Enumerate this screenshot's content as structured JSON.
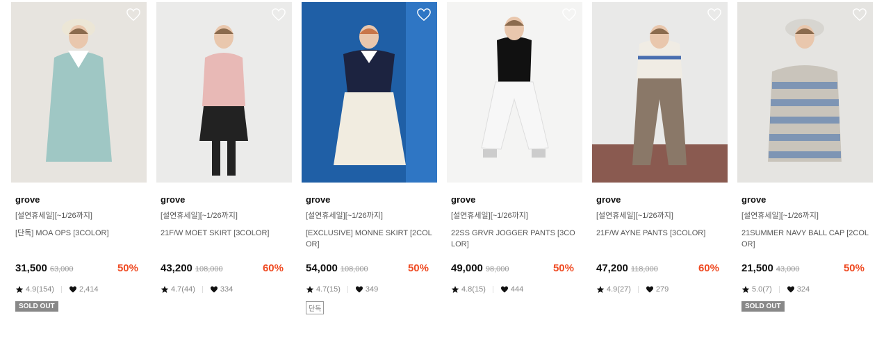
{
  "products": [
    {
      "brand": "grove",
      "promo": "[설연휴세일][~1/26까지]",
      "name": "[단독] MOA OPS [3COLOR]",
      "price": "31,500",
      "original_price": "63,000",
      "discount": "50%",
      "rating": "4.9(154)",
      "likes": "2,414",
      "badge": "SOLD OUT",
      "badge_type": "sold",
      "bg": "#e7e4df",
      "accent": "#9fc7c4"
    },
    {
      "brand": "grove",
      "promo": "[설연휴세일][~1/26까지]",
      "name": "21F/W MOET SKIRT [3COLOR]",
      "price": "43,200",
      "original_price": "108,000",
      "discount": "60%",
      "rating": "4.7(44)",
      "likes": "334",
      "badge": "",
      "badge_type": "",
      "bg": "#ebebea",
      "accent": "#e8b9b6"
    },
    {
      "brand": "grove",
      "promo": "[설연휴세일][~1/26까지]",
      "name": "[EXCLUSIVE] MONNE SKIRT [2COLOR]",
      "price": "54,000",
      "original_price": "108,000",
      "discount": "50%",
      "rating": "4.7(15)",
      "likes": "349",
      "badge": "단독",
      "badge_type": "excl",
      "bg": "#2a6cb3",
      "accent": "#f1ece0"
    },
    {
      "brand": "grove",
      "promo": "[설연휴세일][~1/26까지]",
      "name": "22SS GRVR JOGGER PANTS [3COLOR]",
      "price": "49,000",
      "original_price": "98,000",
      "discount": "50%",
      "rating": "4.8(15)",
      "likes": "444",
      "badge": "",
      "badge_type": "",
      "bg": "#f4f4f3",
      "accent": "#f7f7f7"
    },
    {
      "brand": "grove",
      "promo": "[설연휴세일][~1/26까지]",
      "name": "21F/W AYNE PANTS [3COLOR]",
      "price": "47,200",
      "original_price": "118,000",
      "discount": "60%",
      "rating": "4.9(27)",
      "likes": "279",
      "badge": "",
      "badge_type": "",
      "bg": "#e9e9e8",
      "accent": "#8a7868"
    },
    {
      "brand": "grove",
      "promo": "[설연휴세일][~1/26까지]",
      "name": "21SUMMER NAVY BALL CAP [2COLOR]",
      "price": "21,500",
      "original_price": "43,000",
      "discount": "50%",
      "rating": "5.0(7)",
      "likes": "324",
      "badge": "SOLD OUT",
      "badge_type": "sold",
      "bg": "#e5e4e1",
      "accent": "#7e95b4"
    }
  ]
}
